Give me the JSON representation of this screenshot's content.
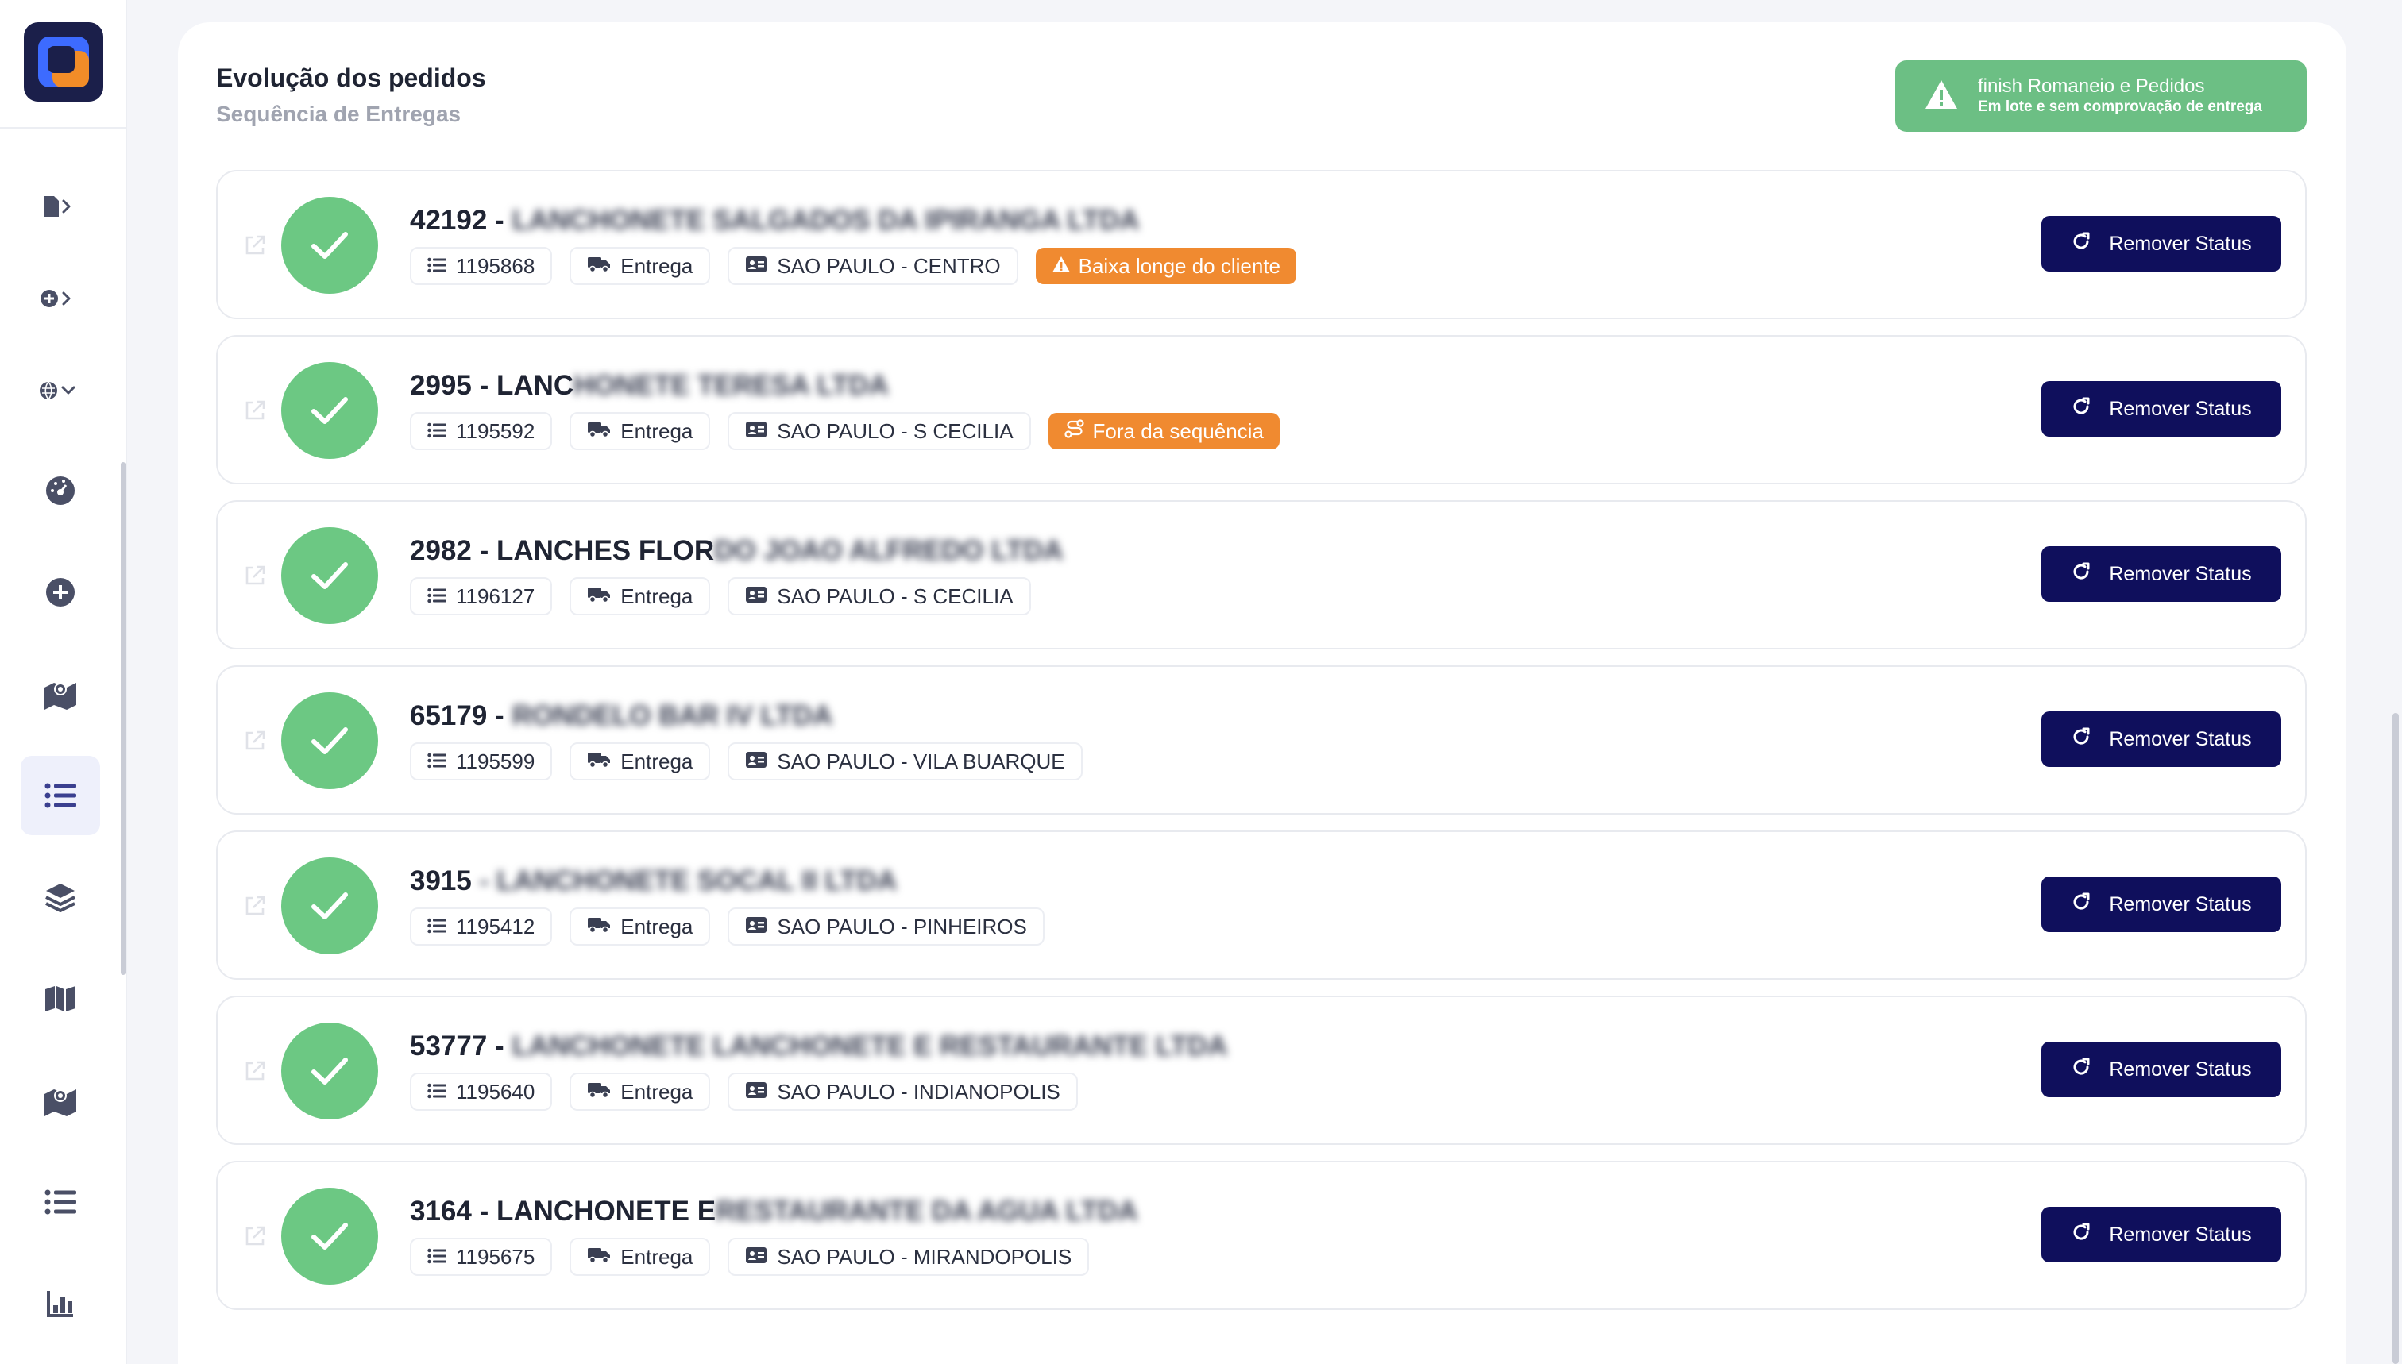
{
  "header": {
    "title": "Evolução dos pedidos",
    "subtitle": "Sequência de Entregas"
  },
  "finish_button": {
    "line1": "finish Romaneio e Pedidos",
    "line2": "Em lote e sem comprovação de entrega",
    "color": "#6cbf84"
  },
  "sidebar": {
    "items": [
      {
        "icon": "pdf-file-icon"
      },
      {
        "icon": "plus-circle-icon"
      },
      {
        "icon": "globe-icon"
      },
      {
        "icon": "dashboard-gauge-icon"
      },
      {
        "icon": "add-circle-icon"
      },
      {
        "icon": "map-marker-icon"
      },
      {
        "icon": "list-icon",
        "active": true
      },
      {
        "icon": "layers-icon"
      },
      {
        "icon": "map-icon"
      },
      {
        "icon": "map-location-icon"
      },
      {
        "icon": "list-icon"
      },
      {
        "icon": "bar-chart-icon"
      }
    ]
  },
  "colors": {
    "accent_navy": "#0f0f5c",
    "success_green": "#6cc883",
    "warning_orange": "#f08a30"
  },
  "orders": [
    {
      "title": "42192 - ",
      "title_blurred": "LANCHONETE SALGADOS DA IPIRANGA LTDA",
      "code": "1195868",
      "type": "Entrega",
      "location": "SAO PAULO - CENTRO",
      "badge": "Baixa longe do cliente",
      "badge_icon": "warning-icon",
      "button": "Remover Status"
    },
    {
      "title": "2995 - LANC",
      "title_blurred": "HONETE TERESA LTDA",
      "code": "1195592",
      "type": "Entrega",
      "location": "SAO PAULO - S CECILIA",
      "badge": "Fora da sequência",
      "badge_icon": "route-icon",
      "button": "Remover Status"
    },
    {
      "title": "2982 - LANCHES FLOR",
      "title_blurred": " DO JOAO ALFREDO LTDA",
      "code": "1196127",
      "type": "Entrega",
      "location": "SAO PAULO - S CECILIA",
      "badge": "",
      "button": "Remover Status"
    },
    {
      "title": "65179 - ",
      "title_blurred": "RONDELO BAR IV LTDA",
      "code": "1195599",
      "type": "Entrega",
      "location": "SAO PAULO - VILA BUARQUE",
      "badge": "",
      "button": "Remover Status"
    },
    {
      "title": "3915 ",
      "title_blurred": "- LANCHONETE SOCAL II LTDA",
      "code": "1195412",
      "type": "Entrega",
      "location": "SAO PAULO - PINHEIROS",
      "badge": "",
      "button": "Remover Status"
    },
    {
      "title": "53777 - ",
      "title_blurred": "LANCHONETE LANCHONETE E RESTAURANTE LTDA",
      "code": "1195640",
      "type": "Entrega",
      "location": "SAO PAULO - INDIANOPOLIS",
      "badge": "",
      "button": "Remover Status"
    },
    {
      "title": "3164 - LANCHONETE E",
      "title_blurred": " RESTAURANTE DA AGUA LTDA",
      "code": "1195675",
      "type": "Entrega",
      "location": "SAO PAULO - MIRANDOPOLIS",
      "badge": "",
      "button": "Remover Status"
    }
  ]
}
